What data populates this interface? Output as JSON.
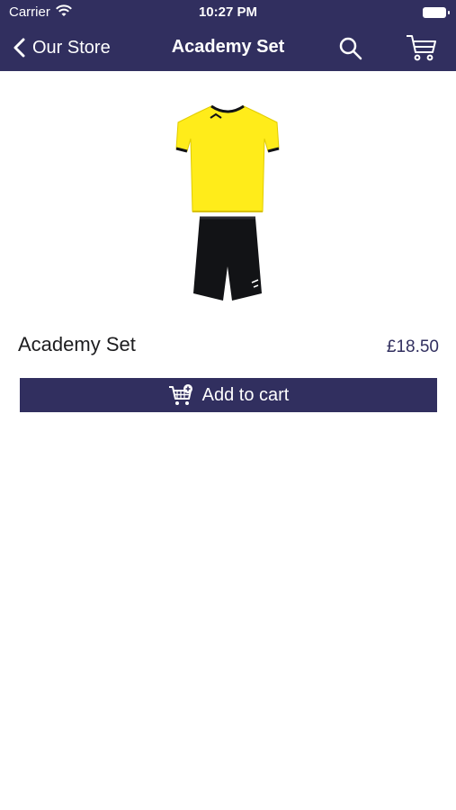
{
  "status_bar": {
    "carrier": "Carrier",
    "time": "10:27 PM"
  },
  "nav": {
    "back_label": "Our Store",
    "title": "Academy Set"
  },
  "product": {
    "name": "Academy Set",
    "price": "£18.50",
    "image_icon": "academy-set-kit-image"
  },
  "actions": {
    "add_to_cart": "Add to cart"
  },
  "colors": {
    "brand": "#312f5f",
    "shirt": "#ffec1a",
    "shorts": "#121316"
  }
}
